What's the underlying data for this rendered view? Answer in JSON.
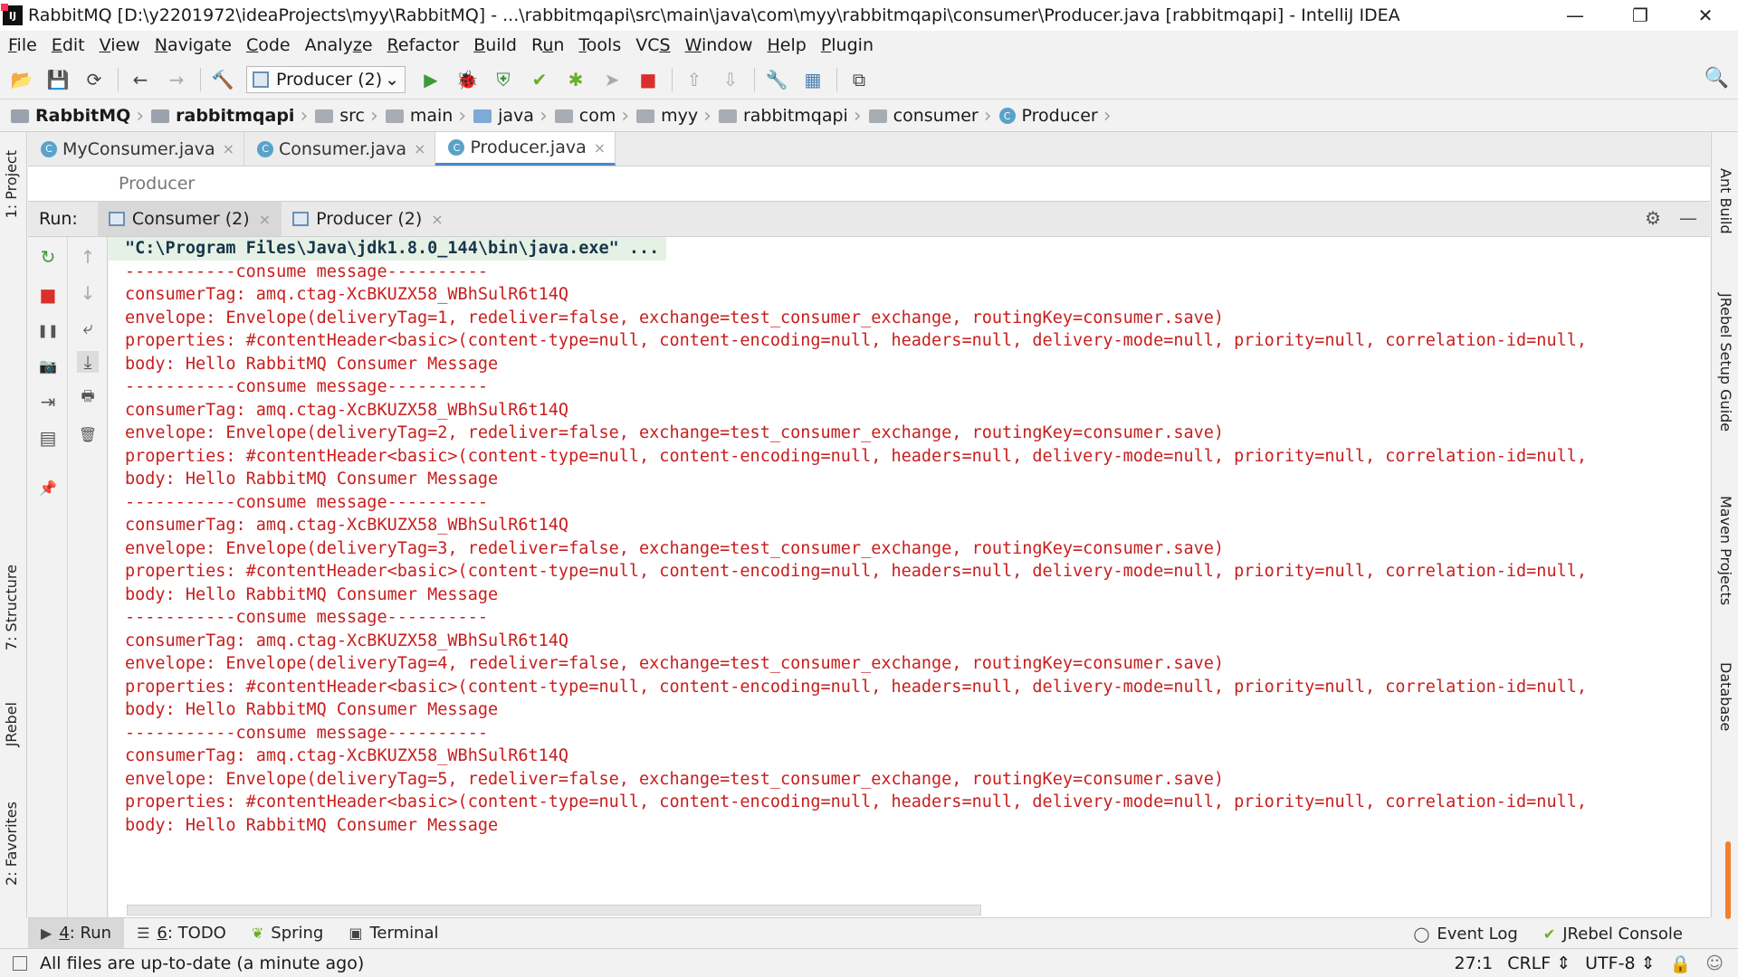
{
  "window": {
    "app_icon": "IJ",
    "title": "RabbitMQ [D:\\y2201972\\ideaProjects\\myy\\RabbitMQ] - ...\\rabbitmqapi\\src\\main\\java\\com\\myy\\rabbitmqapi\\consumer\\Producer.java [rabbitmqapi] - IntelliJ IDEA",
    "minimize": "—",
    "restore": "❐",
    "close": "✕"
  },
  "menu": [
    {
      "pre": "",
      "u": "F",
      "post": "ile"
    },
    {
      "pre": "",
      "u": "E",
      "post": "dit"
    },
    {
      "pre": "",
      "u": "V",
      "post": "iew"
    },
    {
      "pre": "",
      "u": "N",
      "post": "avigate"
    },
    {
      "pre": "",
      "u": "C",
      "post": "ode"
    },
    {
      "pre": "Analy",
      "u": "z",
      "post": "e"
    },
    {
      "pre": "",
      "u": "R",
      "post": "efactor"
    },
    {
      "pre": "",
      "u": "B",
      "post": "uild"
    },
    {
      "pre": "R",
      "u": "u",
      "post": "n"
    },
    {
      "pre": "",
      "u": "T",
      "post": "ools"
    },
    {
      "pre": "VC",
      "u": "S",
      "post": ""
    },
    {
      "pre": "",
      "u": "W",
      "post": "indow"
    },
    {
      "pre": "",
      "u": "H",
      "post": "elp"
    },
    {
      "pre": "",
      "u": "P",
      "post": "lugin"
    }
  ],
  "toolbar": {
    "run_config_label": "Producer (2)",
    "dropdown_glyph": "⌄",
    "icons": {
      "open": "📂",
      "save": "💾",
      "sync": "⟳",
      "back": "←",
      "forward": "→",
      "build": "🔨",
      "run": "▶",
      "debug": "🐞",
      "coverage": "⛨",
      "jrebel_run": "✔",
      "jrebel_debug": "✱",
      "profile": "➤",
      "stop": "■",
      "vcs1": "⇧",
      "vcs2": "⇩",
      "settings": "🔧",
      "structure": "▦",
      "sdk": "⧉",
      "search": "🔍"
    }
  },
  "breadcrumb": [
    {
      "label": "RabbitMQ",
      "kind": "project",
      "bold": true
    },
    {
      "label": "rabbitmqapi",
      "kind": "project",
      "bold": true
    },
    {
      "label": "src",
      "kind": "folder",
      "bold": false
    },
    {
      "label": "main",
      "kind": "folder",
      "bold": false
    },
    {
      "label": "java",
      "kind": "blue",
      "bold": false
    },
    {
      "label": "com",
      "kind": "folder",
      "bold": false
    },
    {
      "label": "myy",
      "kind": "folder",
      "bold": false
    },
    {
      "label": "rabbitmqapi",
      "kind": "folder",
      "bold": false
    },
    {
      "label": "consumer",
      "kind": "folder",
      "bold": false
    },
    {
      "label": "Producer",
      "kind": "class",
      "bold": false
    }
  ],
  "class_glyph": "C",
  "editor_tabs": [
    {
      "label": "MyConsumer.java",
      "active": false
    },
    {
      "label": "Consumer.java",
      "active": false
    },
    {
      "label": "Producer.java",
      "active": true
    }
  ],
  "close_glyph": "×",
  "chevron": "›",
  "editor_breadcrumb": "Producer",
  "left_strip": {
    "project": "1: Project",
    "structure": "7: Structure",
    "jrebel": "JRebel",
    "favorites": "2: Favorites"
  },
  "right_strip": {
    "ant": "Ant Build",
    "jrebel_guide": "JRebel Setup Guide",
    "maven": "Maven Projects",
    "database": "Database"
  },
  "run_panel": {
    "label": "Run:",
    "tabs": [
      {
        "label": "Consumer (2)",
        "active": true
      },
      {
        "label": "Producer (2)",
        "active": false
      }
    ],
    "settings_icon": "⚙",
    "minimize_icon": "—"
  },
  "run_toolbar": {
    "rerun": "↻",
    "stop": "■",
    "pause": "❚❚",
    "dump": "📷",
    "login": "⇥",
    "layout": "▤",
    "pin": "📌",
    "up": "↑",
    "down": "↓",
    "wrap": "⤶",
    "scroll_end": "⤓",
    "print": "🖶",
    "clear": "🗑"
  },
  "console": {
    "command": "\"C:\\Program Files\\Java\\jdk1.8.0_144\\bin\\java.exe\" ...",
    "lines": [
      "-----------consume message----------",
      "consumerTag: amq.ctag-XcBKUZX58_WBhSulR6t14Q",
      "envelope: Envelope(deliveryTag=1, redeliver=false, exchange=test_consumer_exchange, routingKey=consumer.save)",
      "properties: #contentHeader<basic>(content-type=null, content-encoding=null, headers=null, delivery-mode=null, priority=null, correlation-id=null,",
      "body: Hello RabbitMQ Consumer Message",
      "-----------consume message----------",
      "consumerTag: amq.ctag-XcBKUZX58_WBhSulR6t14Q",
      "envelope: Envelope(deliveryTag=2, redeliver=false, exchange=test_consumer_exchange, routingKey=consumer.save)",
      "properties: #contentHeader<basic>(content-type=null, content-encoding=null, headers=null, delivery-mode=null, priority=null, correlation-id=null,",
      "body: Hello RabbitMQ Consumer Message",
      "-----------consume message----------",
      "consumerTag: amq.ctag-XcBKUZX58_WBhSulR6t14Q",
      "envelope: Envelope(deliveryTag=3, redeliver=false, exchange=test_consumer_exchange, routingKey=consumer.save)",
      "properties: #contentHeader<basic>(content-type=null, content-encoding=null, headers=null, delivery-mode=null, priority=null, correlation-id=null,",
      "body: Hello RabbitMQ Consumer Message",
      "-----------consume message----------",
      "consumerTag: amq.ctag-XcBKUZX58_WBhSulR6t14Q",
      "envelope: Envelope(deliveryTag=4, redeliver=false, exchange=test_consumer_exchange, routingKey=consumer.save)",
      "properties: #contentHeader<basic>(content-type=null, content-encoding=null, headers=null, delivery-mode=null, priority=null, correlation-id=null,",
      "body: Hello RabbitMQ Consumer Message",
      "-----------consume message----------",
      "consumerTag: amq.ctag-XcBKUZX58_WBhSulR6t14Q",
      "envelope: Envelope(deliveryTag=5, redeliver=false, exchange=test_consumer_exchange, routingKey=consumer.save)",
      "properties: #contentHeader<basic>(content-type=null, content-encoding=null, headers=null, delivery-mode=null, priority=null, correlation-id=null,",
      "body: Hello RabbitMQ Consumer Message"
    ]
  },
  "bottom_tabs": {
    "run": {
      "u": "4",
      "post": ": Run"
    },
    "todo": {
      "u": "6",
      "post": ": TODO"
    },
    "spring": "Spring",
    "terminal": "Terminal",
    "event_log": "Event Log",
    "jrebel_console": "JRebel Console"
  },
  "status": {
    "message": "All files are up-to-date (a minute ago)",
    "position": "27:1",
    "line_sep": "CRLF ⇕",
    "encoding": "UTF-8 ⇕"
  },
  "colors": {
    "console_text": "#c81e1e",
    "accent": "#4a88c7",
    "run_green": "#3a9a3a",
    "stop_red": "#d9302c"
  }
}
